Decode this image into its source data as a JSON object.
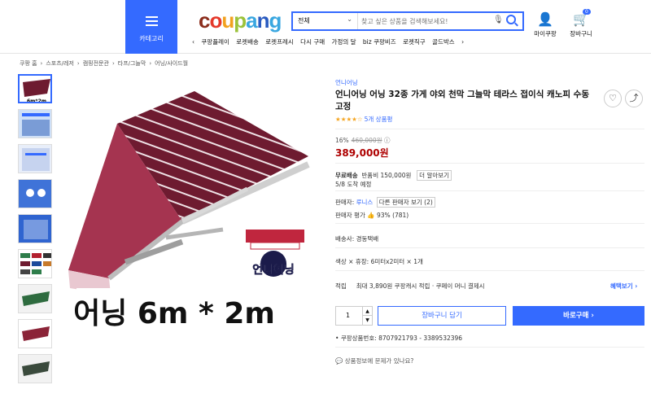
{
  "header": {
    "category_label": "카테고리",
    "logo": [
      "c",
      "o",
      "u",
      "p",
      "a",
      "n",
      "g"
    ],
    "search_select": "전체",
    "search_placeholder": "찾고 싶은 상품을 검색해보세요!",
    "mypage": "마이쿠팡",
    "cart": "장바구니",
    "cart_count": "0",
    "quick_links": [
      "쿠팡플레이",
      "로켓배송",
      "로켓프레시",
      "다시 구매",
      "가정의 달",
      "biz 쿠팡비즈",
      "로켓직구",
      "골드박스"
    ]
  },
  "breadcrumb": [
    "쿠팡 홈",
    "›",
    "스포츠/레저",
    "›",
    "캠핑전문관",
    "›",
    "타프/그늘막",
    "›",
    "어닝/사이드월"
  ],
  "thumbnail_count": 9,
  "image": {
    "main_text": "어닝 6m * 2m",
    "logo_text": "언니어닝"
  },
  "product": {
    "brand": "언니어닝",
    "title": "언니어닝 어닝 32종 가게 야외 천막 그늘막 테라스 접이식 캐노피 수동 고정",
    "rating_stars": "★★★★☆",
    "review_count": "5개 상품평",
    "discount": "16%",
    "original_price": "460,000원",
    "price": "389,000원",
    "shipping_label": "무료배송",
    "shipping_cond": "반품비 150,000원",
    "shipping_extra": "더 알아보기",
    "delivery_date": "5/8 도착 예정",
    "seller_label": "판매자:",
    "seller_name": "루니스",
    "seller_more": "다른 판매자 보기",
    "seller_more_count": "2",
    "seller_rating_label": "판매자 평가",
    "seller_rating": "93% (781)",
    "delivery_label": "배송사: 경동택배",
    "option_label": "색상 × 휴장: 6미터x2미터 × 1개",
    "reward_label": "적립",
    "reward_text": "최대 3,890원 쿠팡캐시 적립 · 쿠페이 머니 결제시",
    "reward_link": "혜택보기",
    "quantity": "1",
    "cart_button": "장바구니 담기",
    "buy_button": "바로구매",
    "product_no": "쿠팡상품번호: 8707921793 - 3389532396",
    "report": "상품정보에 문제가 있나요?"
  },
  "colors": {
    "accent": "#346aff",
    "price": "#ae0000",
    "awning": "#6e1b30"
  }
}
